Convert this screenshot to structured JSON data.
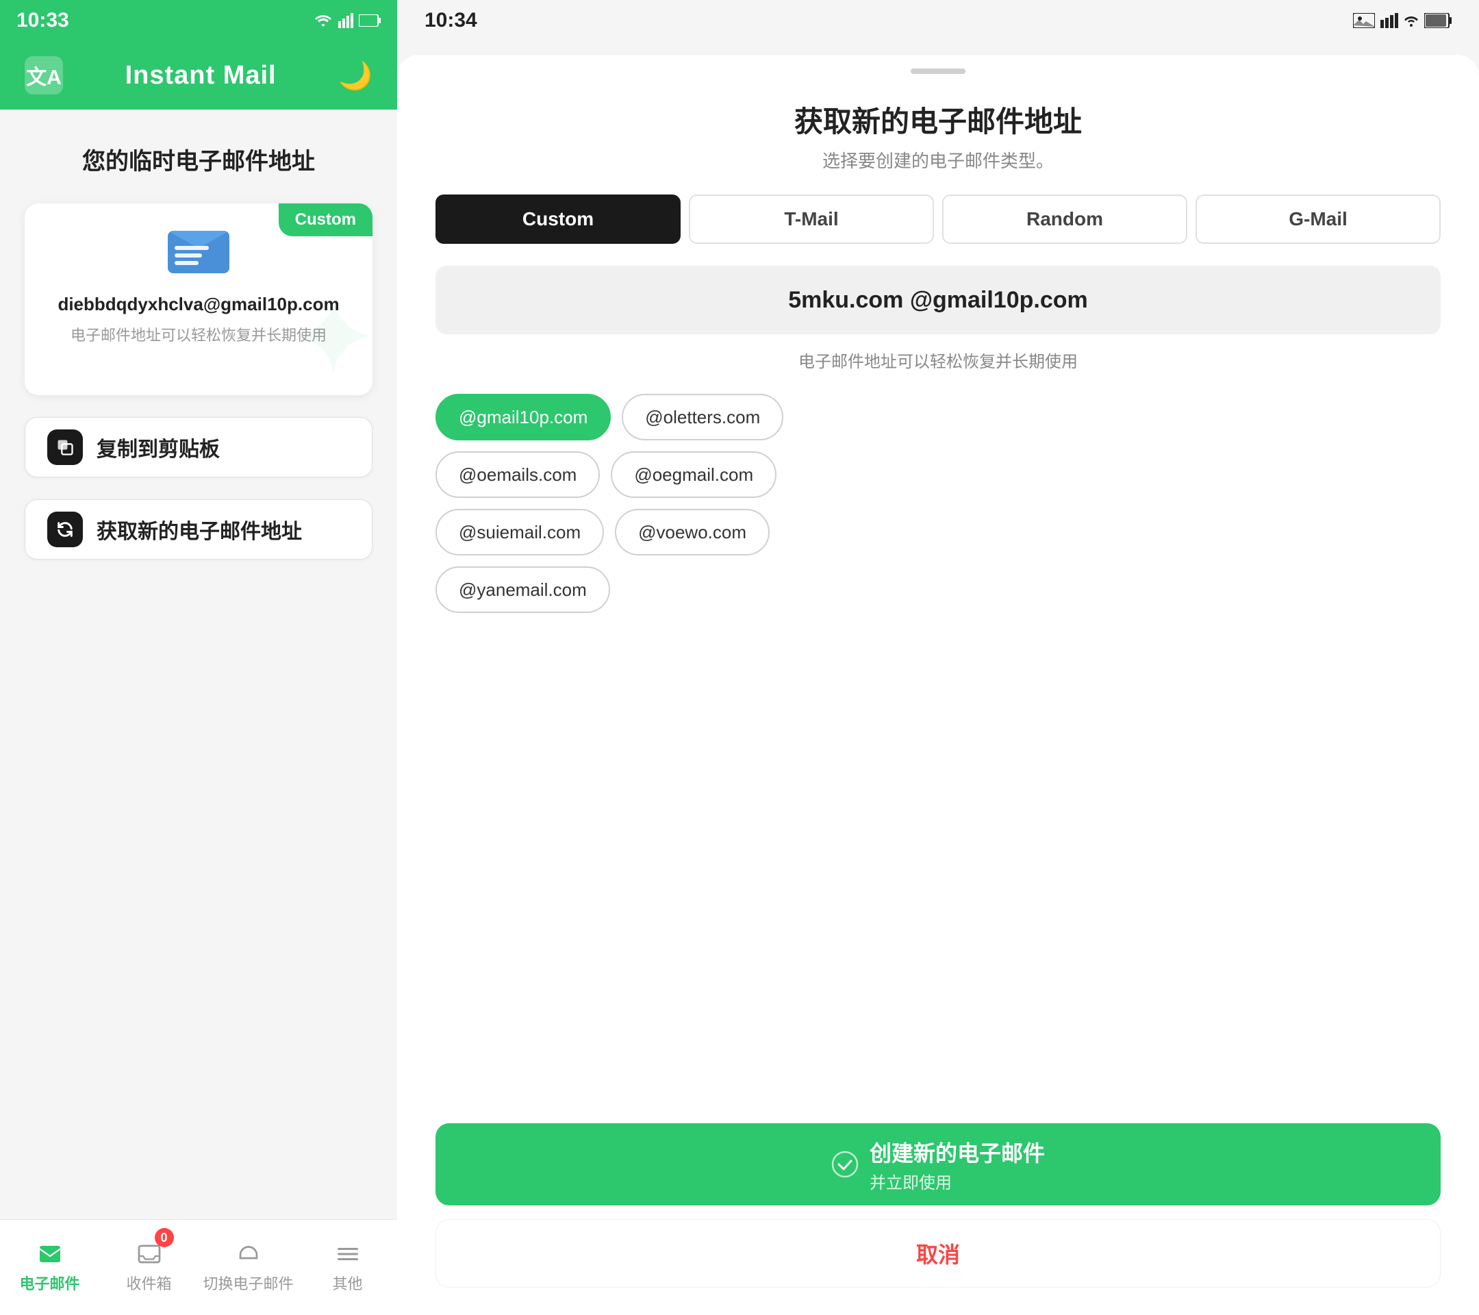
{
  "leftPhone": {
    "statusBar": {
      "time": "10:33",
      "icons": "▲"
    },
    "header": {
      "title": "Instant Mail",
      "translateIcon": "文A",
      "moonIcon": "🌙"
    },
    "pageTitle": "您的临时电子邮件地址",
    "emailCard": {
      "customBadge": "Custom",
      "emailAddress": "diebbdqdyxhclva@gmail10p.com",
      "subtitle": "电子邮件地址可以轻松恢复并长期使用"
    },
    "copyBtn": {
      "label": "复制到剪贴板"
    },
    "newEmailBtn": {
      "label": "获取新的电子邮件地址"
    },
    "bottomNav": {
      "items": [
        {
          "id": "email",
          "label": "电子邮件",
          "active": true
        },
        {
          "id": "inbox",
          "label": "收件箱",
          "badge": "0"
        },
        {
          "id": "switch",
          "label": "切换电子邮件"
        },
        {
          "id": "more",
          "label": "其他"
        }
      ]
    }
  },
  "rightPhone": {
    "statusBar": {
      "time": "10:34"
    },
    "modal": {
      "title": "获取新的电子邮件地址",
      "subtitle": "选择要创建的电子邮件类型。",
      "tabs": [
        {
          "id": "custom",
          "label": "Custom",
          "active": true
        },
        {
          "id": "tmail",
          "label": "T-Mail"
        },
        {
          "id": "random",
          "label": "Random"
        },
        {
          "id": "gmail",
          "label": "G-Mail"
        }
      ],
      "domainPreview": {
        "text": "5mku.com @gmail10p.com"
      },
      "domainHint": "电子邮件地址可以轻松恢复并长期使用",
      "domains": [
        {
          "label": "@gmail10p.com",
          "selected": true
        },
        {
          "label": "@oletters.com",
          "selected": false
        },
        {
          "label": "@oemails.com",
          "selected": false
        },
        {
          "label": "@oegmail.com",
          "selected": false
        },
        {
          "label": "@suiemail.com",
          "selected": false
        },
        {
          "label": "@voewo.com",
          "selected": false
        },
        {
          "label": "@yanemail.com",
          "selected": false
        }
      ],
      "createBtn": {
        "icon": "✓",
        "label": "创建新的电子邮件",
        "sub": "并立即使用"
      },
      "cancelBtn": {
        "label": "取消"
      }
    }
  }
}
